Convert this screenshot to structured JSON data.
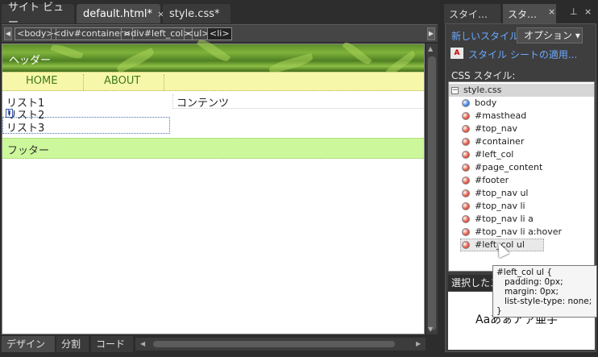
{
  "editor": {
    "tabs": [
      {
        "label": "サイト ビュー",
        "close": ""
      },
      {
        "label": "default.html*",
        "close": "×"
      },
      {
        "label": "style.css*",
        "close": ""
      }
    ],
    "breadcrumb": [
      "<body>",
      "<div#container>",
      "<div#left_col>",
      "<ul>",
      "<li>"
    ],
    "design": {
      "masthead_text": "ヘッダー",
      "nav": [
        "HOME",
        "ABOUT"
      ],
      "list_items": [
        "リスト1",
        "リスト2",
        "リスト3"
      ],
      "li_tag": "li",
      "content_text": "コンテンツ",
      "footer_text": "フッター"
    },
    "view_buttons": [
      "デザイン",
      "分割",
      "コード"
    ]
  },
  "panel": {
    "tabs": [
      "スタイ…",
      "スタ…"
    ],
    "tab_close": "×",
    "pin_icon": "📌",
    "close_icon": "×",
    "new_style": "新しいスタイル...",
    "option_button": "オプション ▾",
    "apply_sheet": "スタイル シートの適用...",
    "css_label": "CSS スタイル:",
    "tree_root": "style.css",
    "rules": [
      {
        "label": "body",
        "color": "#3b7de0"
      },
      {
        "label": "#masthead",
        "color": "#e0523b"
      },
      {
        "label": "#top_nav",
        "color": "#e0523b"
      },
      {
        "label": "#container",
        "color": "#e0523b"
      },
      {
        "label": "#left_col",
        "color": "#e0523b"
      },
      {
        "label": "#page_content",
        "color": "#e0523b"
      },
      {
        "label": "#footer",
        "color": "#e0523b"
      },
      {
        "label": "#top_nav ul",
        "color": "#e0523b"
      },
      {
        "label": "#top_nav li",
        "color": "#e0523b"
      },
      {
        "label": "#top_nav li a",
        "color": "#e0523b"
      },
      {
        "label": "#top_nav li a:hover",
        "color": "#e0523b"
      },
      {
        "label": "#left_col ul",
        "color": "#e0523b"
      }
    ],
    "selected_label": "選択したスタ",
    "preview_text": "Aaあぁアァ亜宇"
  },
  "tooltip": {
    "lines": [
      "#left_col ul {",
      "padding: 0px;",
      "margin: 0px;",
      "list-style-type: none;",
      "}"
    ]
  }
}
